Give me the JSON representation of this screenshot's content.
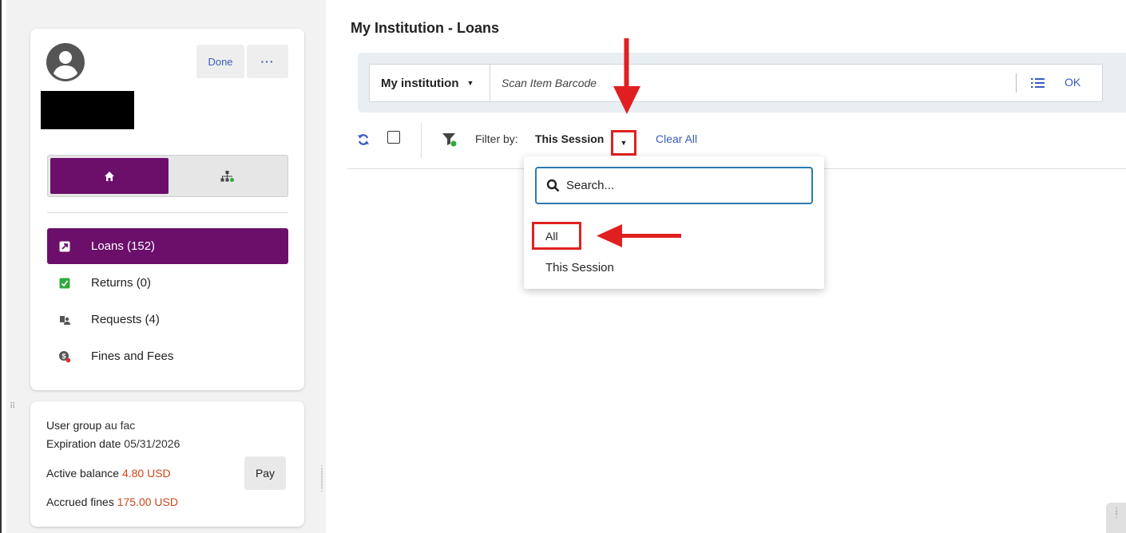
{
  "main": {
    "title": "My Institution - Loans",
    "scan": {
      "scope_label": "My institution",
      "placeholder": "Scan Item Barcode",
      "ok_label": "OK"
    },
    "toolbar": {
      "filter_by_label": "Filter by:",
      "filter_value": "This Session",
      "clear_all_label": "Clear All"
    },
    "filter_dropdown": {
      "search_placeholder": "Search...",
      "options": [
        "All",
        "This Session"
      ]
    }
  },
  "user_card": {
    "done_label": "Done",
    "more_label": "···",
    "menu": [
      {
        "label": "Loans (152)",
        "icon": "loan-icon",
        "active": true
      },
      {
        "label": "Returns (0)",
        "icon": "return-icon",
        "active": false
      },
      {
        "label": "Requests (4)",
        "icon": "request-icon",
        "active": false
      },
      {
        "label": "Fines and Fees",
        "icon": "fines-icon",
        "active": false
      }
    ]
  },
  "info_card": {
    "user_group_label": "User group",
    "user_group_value": "au fac",
    "expiration_label": "Expiration date",
    "expiration_value": "05/31/2026",
    "active_balance_label": "Active balance",
    "active_balance_value": "4.80 USD",
    "accrued_fines_label": "Accrued fines",
    "accrued_fines_value": "175.00 USD",
    "pay_label": "Pay"
  },
  "colors": {
    "accent_purple": "#6b0f6b",
    "link_blue": "#3a5bbf",
    "money_red": "#d0451b",
    "annotation_red": "#e02020",
    "focus_blue": "#2d7ab0"
  }
}
